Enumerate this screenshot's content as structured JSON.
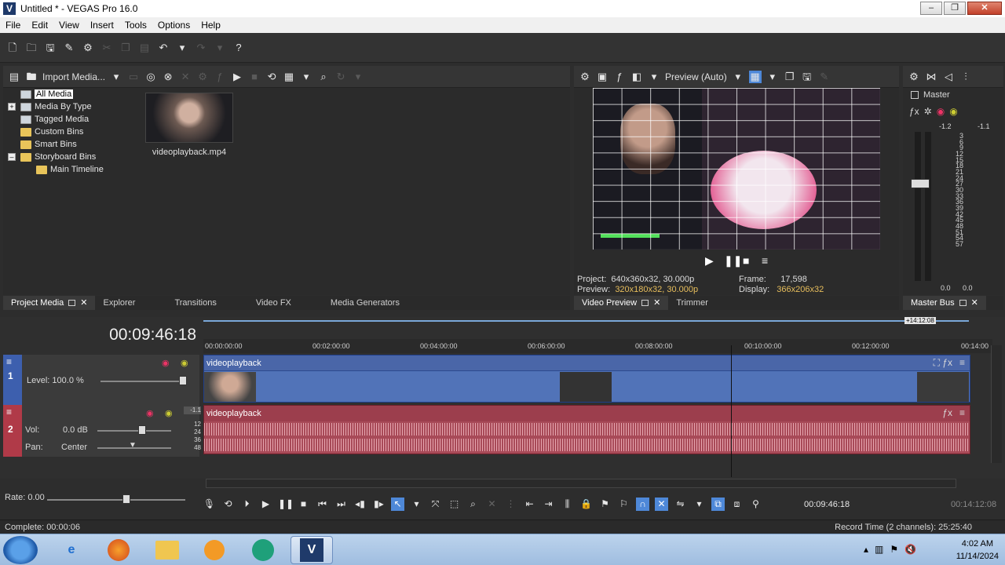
{
  "window": {
    "title": "Untitled * - VEGAS Pro 16.0",
    "icon_letter": "V",
    "controls": [
      "–",
      "❐",
      "✕"
    ]
  },
  "menu": [
    "File",
    "Edit",
    "View",
    "Insert",
    "Tools",
    "Options",
    "Help"
  ],
  "project_media": {
    "import_label": "Import Media...",
    "tree": [
      {
        "label": "All Media",
        "selected": true,
        "expander": ""
      },
      {
        "label": "Media By Type",
        "expander": "+"
      },
      {
        "label": "Tagged Media",
        "expander": ""
      },
      {
        "label": "Custom Bins",
        "expander": ""
      },
      {
        "label": "Smart Bins",
        "expander": ""
      },
      {
        "label": "Storyboard Bins",
        "expander": "–"
      },
      {
        "label": "Main Timeline",
        "expander": "",
        "indent": true
      }
    ],
    "file_name": "videoplayback.mp4",
    "tabs": [
      "Project Media",
      "Explorer",
      "Transitions",
      "Video FX",
      "Media Generators"
    ]
  },
  "preview": {
    "mode": "Preview (Auto)",
    "project_label": "Project:",
    "project_value": "640x360x32, 30.000p",
    "preview_label": "Preview:",
    "preview_value": "320x180x32, 30.000p",
    "frame_label": "Frame:",
    "frame_value": "17,598",
    "display_label": "Display:",
    "display_value": "366x206x32",
    "tabs": [
      "Video Preview",
      "Trimmer"
    ]
  },
  "master_bus": {
    "label": "Master",
    "peak_left": "-1.2",
    "peak_right": "-1.1",
    "scale": [
      "3",
      "6",
      "9",
      "12",
      "15",
      "18",
      "21",
      "24",
      "27",
      "30",
      "33",
      "36",
      "39",
      "42",
      "45",
      "48",
      "51",
      "54",
      "57"
    ],
    "bottom_left": "0.0",
    "bottom_right": "0.0",
    "tab": "Master Bus"
  },
  "timeline": {
    "cursor_time": "00:09:46:18",
    "end_marker": "+14:12:08",
    "ruler": [
      "00:00:00:00",
      "00:02:00:00",
      "00:04:00:00",
      "00:06:00:00",
      "00:08:00:00",
      "00:10:00:00",
      "00:12:00:00",
      "00:14:00"
    ],
    "video_track": {
      "number": "1",
      "level_label": "Level: 100.0 %",
      "clip_name": "videoplayback"
    },
    "audio_track": {
      "number": "2",
      "vol_label": "Vol:",
      "vol_value": "0.0 dB",
      "pan_label": "Pan:",
      "pan_value": "Center",
      "meter": [
        "-1.1",
        "12",
        "24",
        "36",
        "48"
      ],
      "clip_name": "videoplayback"
    },
    "rate_label": "Rate: 0.00",
    "transport_time": "00:09:46:18",
    "transport_end": "00:14:12:08"
  },
  "status": {
    "left": "Complete: 00:00:06",
    "right": "Record Time (2 channels): 25:25:40"
  },
  "taskbar": {
    "time": "4:02 AM",
    "date": "11/14/2024",
    "vegas_letter": "V"
  }
}
